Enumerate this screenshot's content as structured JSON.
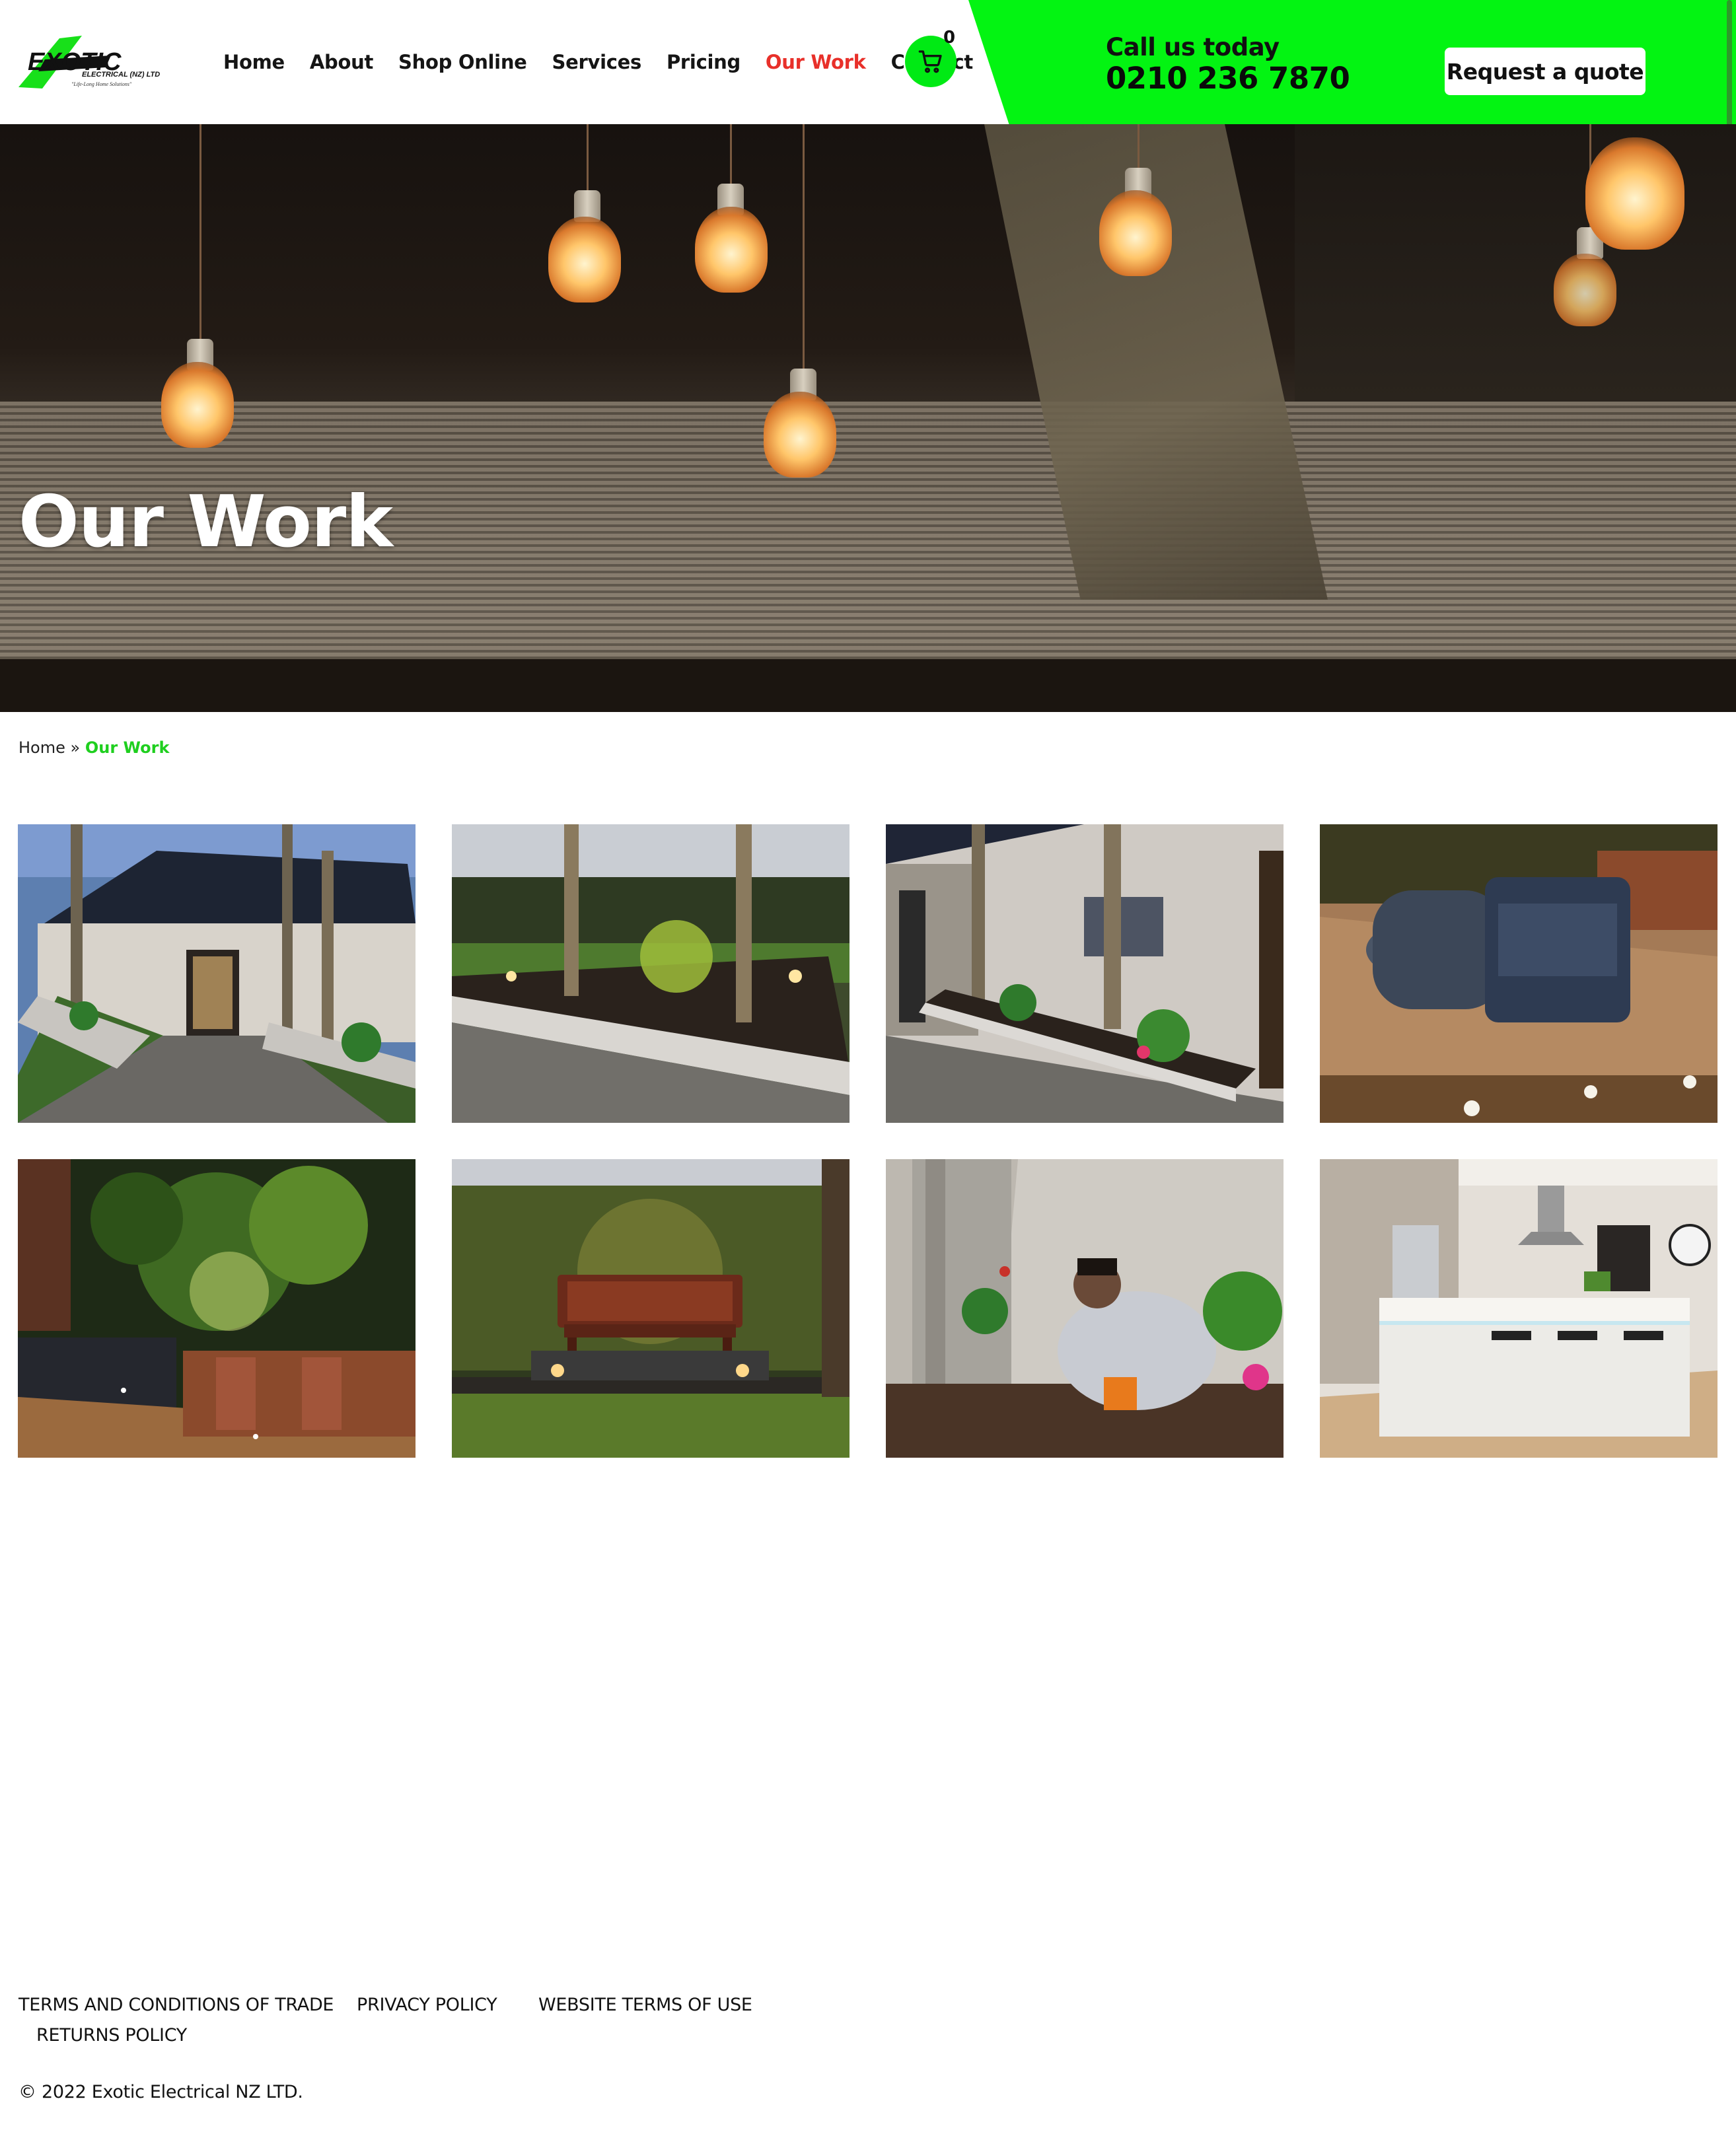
{
  "brand": {
    "name": "EXOTIC",
    "subtitle": "ELECTRICAL (NZ) LTD",
    "tagline": "\"Life-Long Home Solutions\"",
    "accent_color": "#03f412",
    "active_nav_color": "#e8302a"
  },
  "nav": {
    "items": [
      {
        "label": "Home"
      },
      {
        "label": "About"
      },
      {
        "label": "Shop Online"
      },
      {
        "label": "Services"
      },
      {
        "label": "Pricing"
      },
      {
        "label": "Our Work",
        "active": true
      },
      {
        "label": "Contact"
      }
    ],
    "cart_count": "0",
    "cart_icon": "shopping-cart-icon"
  },
  "header_cta": {
    "call_label": "Call us today",
    "phone": "0210 236 7870",
    "quote_button": "Request a quote"
  },
  "hero": {
    "title": "Our Work"
  },
  "breadcrumb": {
    "home": "Home",
    "separator": "»",
    "current": "Our Work"
  },
  "gallery": {
    "items": [
      {
        "subject": "house-front-garden-lighting"
      },
      {
        "subject": "lit-garden-bed-palms"
      },
      {
        "subject": "house-side-garden-lighting"
      },
      {
        "subject": "wicker-outdoor-furniture-deck"
      },
      {
        "subject": "tropical-garden-deck"
      },
      {
        "subject": "garden-bench-hedge"
      },
      {
        "subject": "woman-planting-garden"
      },
      {
        "subject": "modern-kitchen-island"
      }
    ]
  },
  "footer": {
    "links": [
      {
        "label": "TERMS AND CONDITIONS OF TRADE"
      },
      {
        "label": "PRIVACY POLICY"
      },
      {
        "label": "WEBSITE TERMS OF USE"
      },
      {
        "label": "RETURNS POLICY"
      }
    ],
    "copyright": "© 2022 Exotic Electrical NZ LTD."
  }
}
